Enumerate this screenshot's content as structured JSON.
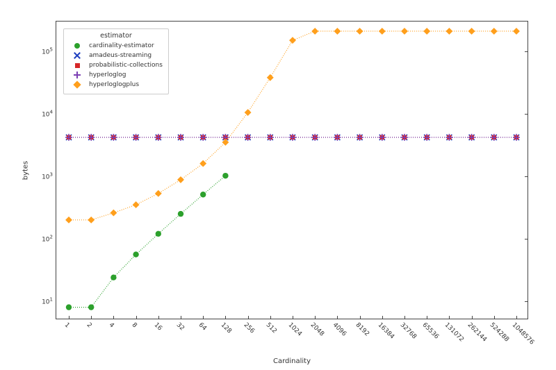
{
  "chart_data": {
    "type": "line",
    "xlabel": "Cardinality",
    "ylabel": "bytes",
    "xscale": "categorical",
    "yscale": "log",
    "ylim": [
      5,
      300000
    ],
    "categories": [
      "1",
      "2",
      "4",
      "8",
      "16",
      "32",
      "64",
      "128",
      "256",
      "512",
      "1024",
      "2048",
      "4096",
      "8192",
      "16384",
      "32768",
      "65536",
      "131072",
      "262144",
      "524288",
      "1048576"
    ],
    "legend_title": "estimator",
    "series": [
      {
        "name": "cardinality-estimator",
        "color": "#2ca02c",
        "marker": "circle",
        "line_dash": "1 2",
        "values": [
          8,
          8,
          24,
          56,
          120,
          250,
          510,
          1020,
          null,
          null,
          null,
          null,
          null,
          null,
          null,
          null,
          null,
          null,
          null,
          null,
          null
        ]
      },
      {
        "name": "amadeus-streaming",
        "color": "#1f3fbf",
        "marker": "x",
        "line_dash": "1 2",
        "values": [
          4200,
          4200,
          4200,
          4200,
          4200,
          4200,
          4200,
          4200,
          4200,
          4200,
          4200,
          4200,
          4200,
          4200,
          4200,
          4200,
          4200,
          4200,
          4200,
          4200,
          4200
        ]
      },
      {
        "name": "probabilistic-collections",
        "color": "#d62728",
        "marker": "square",
        "line_dash": "1 2",
        "values": [
          4200,
          4200,
          4200,
          4200,
          4200,
          4200,
          4200,
          4200,
          4200,
          4200,
          4200,
          4200,
          4200,
          4200,
          4200,
          4200,
          4200,
          4200,
          4200,
          4200,
          4200
        ]
      },
      {
        "name": "hyperloglog",
        "color": "#7b3fb3",
        "marker": "plus",
        "line_dash": "1 2",
        "values": [
          4200,
          4200,
          4200,
          4200,
          4200,
          4200,
          4200,
          4200,
          4200,
          4200,
          4200,
          4200,
          4200,
          4200,
          4200,
          4200,
          4200,
          4200,
          4200,
          4200,
          4200
        ]
      },
      {
        "name": "hyperloglogplus",
        "color": "#ff9f1c",
        "marker": "diamond",
        "line_dash": "1 2",
        "values": [
          200,
          200,
          260,
          350,
          530,
          880,
          1600,
          3500,
          10500,
          38000,
          150000,
          210000,
          210000,
          210000,
          210000,
          210000,
          210000,
          210000,
          210000,
          210000,
          210000
        ]
      }
    ],
    "yticks": [
      10,
      100,
      1000,
      10000,
      100000
    ],
    "ytick_labels": [
      "10¹",
      "10²",
      "10³",
      "10⁴",
      "10⁵"
    ]
  }
}
